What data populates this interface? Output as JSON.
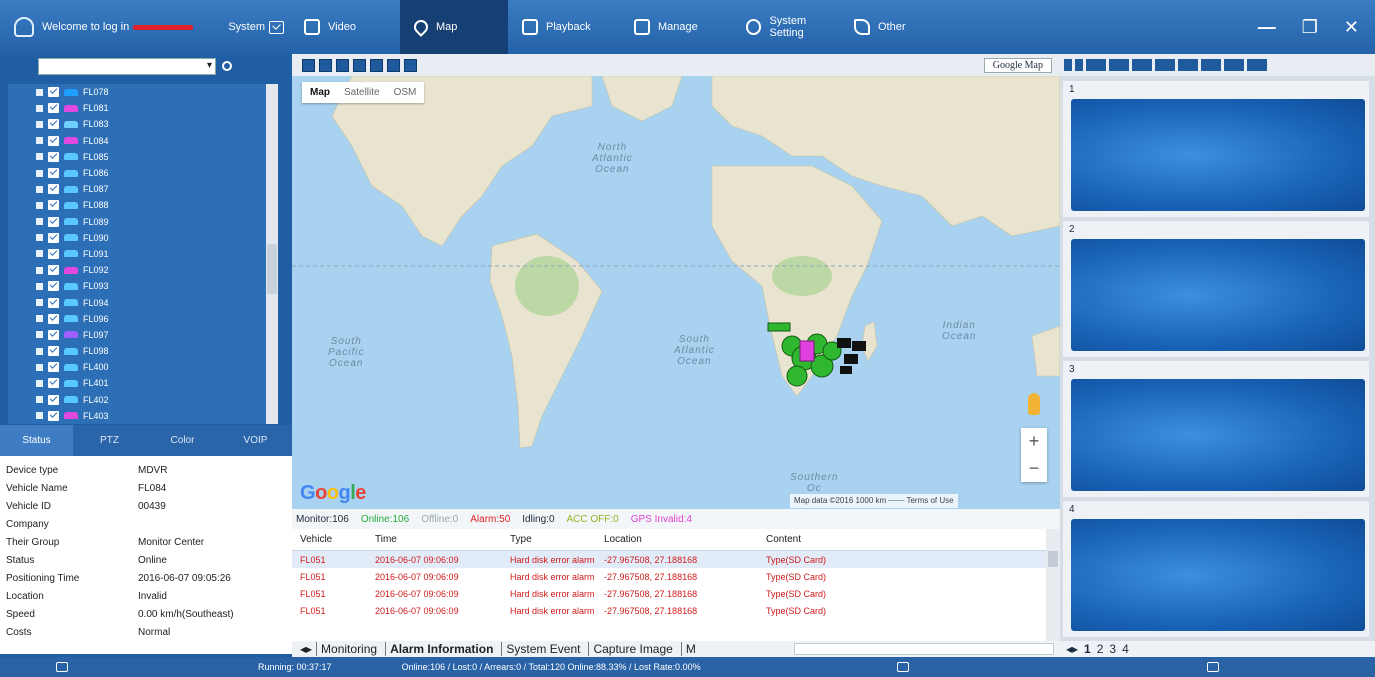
{
  "header": {
    "welcome": "Welcome to log in",
    "system_label": "System",
    "tabs": [
      {
        "label": "Video"
      },
      {
        "label": "Map"
      },
      {
        "label": "Playback"
      },
      {
        "label": "Manage"
      },
      {
        "label": "System Setting"
      },
      {
        "label": "Other"
      }
    ],
    "active_tab": "Map",
    "min_glyph": "—",
    "restore_glyph": "❐",
    "close_glyph": "✕"
  },
  "sidebar": {
    "vehicles": [
      "FL078",
      "FL081",
      "FL083",
      "FL084",
      "FL085",
      "FL086",
      "FL087",
      "FL088",
      "FL089",
      "FL090",
      "FL091",
      "FL092",
      "FL093",
      "FL094",
      "FL096",
      "FL097",
      "FL098",
      "FL400",
      "FL401",
      "FL402",
      "FL403"
    ],
    "vehicle_colors": [
      "#1fa0ff",
      "#e048e0",
      "#6fd0ff",
      "#e048e0",
      "#58c8ff",
      "#58c8ff",
      "#58c8ff",
      "#58c8ff",
      "#58c8ff",
      "#58c8ff",
      "#58c8ff",
      "#e048e0",
      "#58c8ff",
      "#58c8ff",
      "#58c8ff",
      "#a060ff",
      "#58c8ff",
      "#58c8ff",
      "#58c8ff",
      "#58c8ff",
      "#e048e0"
    ],
    "tabs": [
      "Status",
      "PTZ",
      "Color",
      "VOIP"
    ],
    "info": [
      {
        "k": "Device type",
        "v": "MDVR"
      },
      {
        "k": "Vehicle Name",
        "v": "FL084"
      },
      {
        "k": "Vehicle ID",
        "v": "00439"
      },
      {
        "k": "Company",
        "v": ""
      },
      {
        "k": "Their Group",
        "v": "Monitor Center"
      },
      {
        "k": "Status",
        "v": "Online"
      },
      {
        "k": "Positioning Time",
        "v": "2016-06-07 09:05:26"
      },
      {
        "k": "Location",
        "v": "Invalid"
      },
      {
        "k": "Speed",
        "v": "0.00 km/h(Southeast)"
      },
      {
        "k": "Costs",
        "v": "Normal"
      }
    ]
  },
  "map": {
    "provider": "Google Map",
    "types": [
      "Map",
      "Satellite",
      "OSM"
    ],
    "selected_type": "Map",
    "labels": {
      "north_atlantic": "North\nAtlantic\nOcean",
      "south_pacific": "South\nPacific\nOcean",
      "south_atlantic": "South\nAtlantic\nOcean",
      "indian": "Indian\nOcean",
      "southern": "Southern\nOc"
    },
    "logo": "Google",
    "attribution": "Map data ©2016   1000 km ⎯⎯⎯⎯  Terms of Use",
    "zoom_in": "+",
    "zoom_out": "−",
    "land_color": "#e8e4d0",
    "forest_color": "#bcd8a4",
    "water_color": "#a8d2ef"
  },
  "monitor": {
    "monitor": "Monitor:106",
    "online": "Online:106",
    "offline": "Offline:0",
    "alarm": "Alarm:50",
    "idling": "Idling:0",
    "acc_off": "ACC OFF:0",
    "gps_invalid": "GPS Invalid:4",
    "colors": {
      "online": "#22a83a",
      "offline": "#9aa",
      "alarm": "#e02020",
      "acc": "#9ab020",
      "gps": "#e040d0"
    }
  },
  "alarm_table": {
    "columns": [
      "Vehicle",
      "Time",
      "Type",
      "Location",
      "Content"
    ],
    "rows": [
      {
        "vehicle": "FL051",
        "time": "2016-06-07 09:06:09",
        "type": "Hard disk error alarm",
        "location": "-27.967508, 27.188168",
        "content": "Type(SD Card)"
      },
      {
        "vehicle": "FL051",
        "time": "2016-06-07 09:06:09",
        "type": "Hard disk error alarm",
        "location": "-27.967508, 27.188168",
        "content": "Type(SD Card)"
      },
      {
        "vehicle": "FL051",
        "time": "2016-06-07 09:06:09",
        "type": "Hard disk error alarm",
        "location": "-27.967508, 27.188168",
        "content": "Type(SD Card)"
      },
      {
        "vehicle": "FL051",
        "time": "2016-06-07 09:06:09",
        "type": "Hard disk error alarm",
        "location": "-27.967508, 27.188168",
        "content": "Type(SD Card)"
      }
    ]
  },
  "bottom_tabs": [
    "Monitoring",
    "Alarm Information",
    "System Event",
    "Capture Image",
    "M"
  ],
  "active_bottom_tab": "Alarm Information",
  "video": {
    "slots": [
      "1",
      "2",
      "3",
      "4"
    ],
    "pages": [
      "1",
      "2",
      "3",
      "4"
    ],
    "current_page": "1"
  },
  "statusbar": {
    "running": "Running: 00:37:17",
    "counts": "Online:106 / Lost:0 / Arrears:0 / Total:120   Online:88.33% / Lost Rate:0.00%"
  }
}
